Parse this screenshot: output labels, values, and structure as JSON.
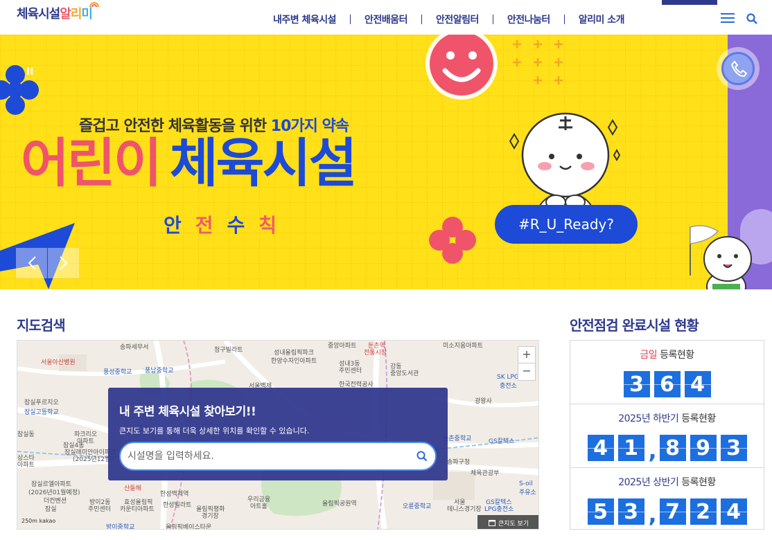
{
  "header": {
    "logo_main": "체육시설",
    "logo_alimi": [
      "알",
      "리",
      "미"
    ],
    "nav": [
      "내주변 체육시설",
      "안전배움터",
      "안전알림터",
      "안전나눔터",
      "알리미 소개"
    ],
    "menu_icon": "hamburger-icon",
    "search_icon": "search-icon"
  },
  "banner": {
    "pause": "II",
    "subtitle_prefix": "즐겁고 안전한 체육활동을 위한 ",
    "subtitle_highlight": "10가지 약속",
    "title_part1": "어린이",
    "title_part2": "체육시설",
    "rules_chars": [
      "안",
      "전",
      "수",
      "칙"
    ],
    "tag": "#R_U_Ready?",
    "colors": {
      "background": "#ffe019",
      "blue": "#1d4ad6",
      "red": "#f0546a",
      "purple": "#8a6ad8"
    }
  },
  "map_section": {
    "title": "지도검색",
    "panel_title": "내 주변 체육시설 찾아보기!!",
    "panel_desc": "큰지도 보기를 통해 더욱 상세한 위치를 확인할 수 있습니다.",
    "search_placeholder": "시설명을 입력하세요.",
    "zoom_in": "+",
    "zoom_out": "−",
    "bigmap_label": "큰지도 보기",
    "scale": "250m",
    "kakao": "kakao",
    "labels": [
      {
        "text": "송파세무서",
        "cls": ""
      },
      {
        "text": "청구빌라트",
        "cls": ""
      },
      {
        "text": "성내올림픽파크",
        "cls": ""
      },
      {
        "text": "한양수자인아파트",
        "cls": ""
      },
      {
        "text": "중앙아파트",
        "cls": ""
      },
      {
        "text": "둔촌역",
        "cls": "red"
      },
      {
        "text": "전통시장",
        "cls": "red"
      },
      {
        "text": "미소지움아파트",
        "cls": ""
      },
      {
        "text": "서울아산병원",
        "cls": "red"
      },
      {
        "text": "풍성중학교",
        "cls": "blue"
      },
      {
        "text": "풍납중학교",
        "cls": "blue"
      },
      {
        "text": "성내3동",
        "cls": ""
      },
      {
        "text": "주민센터",
        "cls": ""
      },
      {
        "text": "강동",
        "cls": ""
      },
      {
        "text": "중앙도서관",
        "cls": ""
      },
      {
        "text": "SK LPG",
        "cls": "blue"
      },
      {
        "text": "충전소",
        "cls": "blue"
      },
      {
        "text": "서울백제",
        "cls": ""
      },
      {
        "text": "한국전력공사",
        "cls": ""
      },
      {
        "text": "광왕사",
        "cls": ""
      },
      {
        "text": "잠실고등학교",
        "cls": "blue"
      },
      {
        "text": "잠실푸르지오",
        "cls": ""
      },
      {
        "text": "잠실동",
        "cls": ""
      },
      {
        "text": "파크리오",
        "cls": ""
      },
      {
        "text": "아파트",
        "cls": ""
      },
      {
        "text": "잠실4동",
        "cls": ""
      },
      {
        "text": "잠실래미안아이파크",
        "cls": ""
      },
      {
        "text": "(2025년12월)",
        "cls": ""
      },
      {
        "text": "상스타",
        "cls": ""
      },
      {
        "text": "아파트",
        "cls": ""
      },
      {
        "text": "둔촌중학교",
        "cls": "blue"
      },
      {
        "text": "GS칼텍스",
        "cls": "blue"
      },
      {
        "text": "잠실르엘아파트",
        "cls": ""
      },
      {
        "text": "(2026년01월예정)",
        "cls": ""
      },
      {
        "text": "더컨벤션",
        "cls": ""
      },
      {
        "text": "잠실",
        "cls": ""
      },
      {
        "text": "방이2동",
        "cls": ""
      },
      {
        "text": "주민센터",
        "cls": ""
      },
      {
        "text": "효성올림픽",
        "cls": ""
      },
      {
        "text": "카운티아파트",
        "cls": ""
      },
      {
        "text": "한성백제역",
        "cls": ""
      },
      {
        "text": "한성빌라트",
        "cls": ""
      },
      {
        "text": "산들해",
        "cls": "red"
      },
      {
        "text": "우리금융",
        "cls": ""
      },
      {
        "text": "아트홀",
        "cls": ""
      },
      {
        "text": "올림픽공원역",
        "cls": ""
      },
      {
        "text": "방이중학교",
        "cls": "blue"
      },
      {
        "text": "올림픽베이스타운",
        "cls": ""
      },
      {
        "text": "오륜중학교",
        "cls": "blue"
      },
      {
        "text": "서울",
        "cls": ""
      },
      {
        "text": "테니스경기장",
        "cls": ""
      },
      {
        "text": "GS칼텍스",
        "cls": "blue"
      },
      {
        "text": "LPG충전소",
        "cls": "blue"
      },
      {
        "text": "S-oil",
        "cls": "blue"
      },
      {
        "text": "주유소",
        "cls": "blue"
      },
      {
        "text": "올림픽평화",
        "cls": ""
      },
      {
        "text": "경기장",
        "cls": ""
      },
      {
        "text": "송파구청",
        "cls": ""
      },
      {
        "text": "체육관광부",
        "cls": ""
      }
    ]
  },
  "stats": {
    "title": "안전점검 완료시설 현황",
    "rows": [
      {
        "label_highlight": "금일",
        "label_rest": " 등록현황",
        "digits": [
          "3",
          "6",
          "4"
        ]
      },
      {
        "label_highlight": "2025년 하반기",
        "label_rest": " 등록현황",
        "digits": [
          "4",
          "1",
          ",",
          "8",
          "9",
          "3"
        ]
      },
      {
        "label_highlight": "2025년 상반기",
        "label_rest": " 등록현황",
        "digits": [
          "5",
          "3",
          ",",
          "7",
          "2",
          "4"
        ]
      }
    ],
    "colors": {
      "digit_bg": "#1d6fe0",
      "today": "#e04050",
      "period": "#2d3a8c"
    }
  }
}
